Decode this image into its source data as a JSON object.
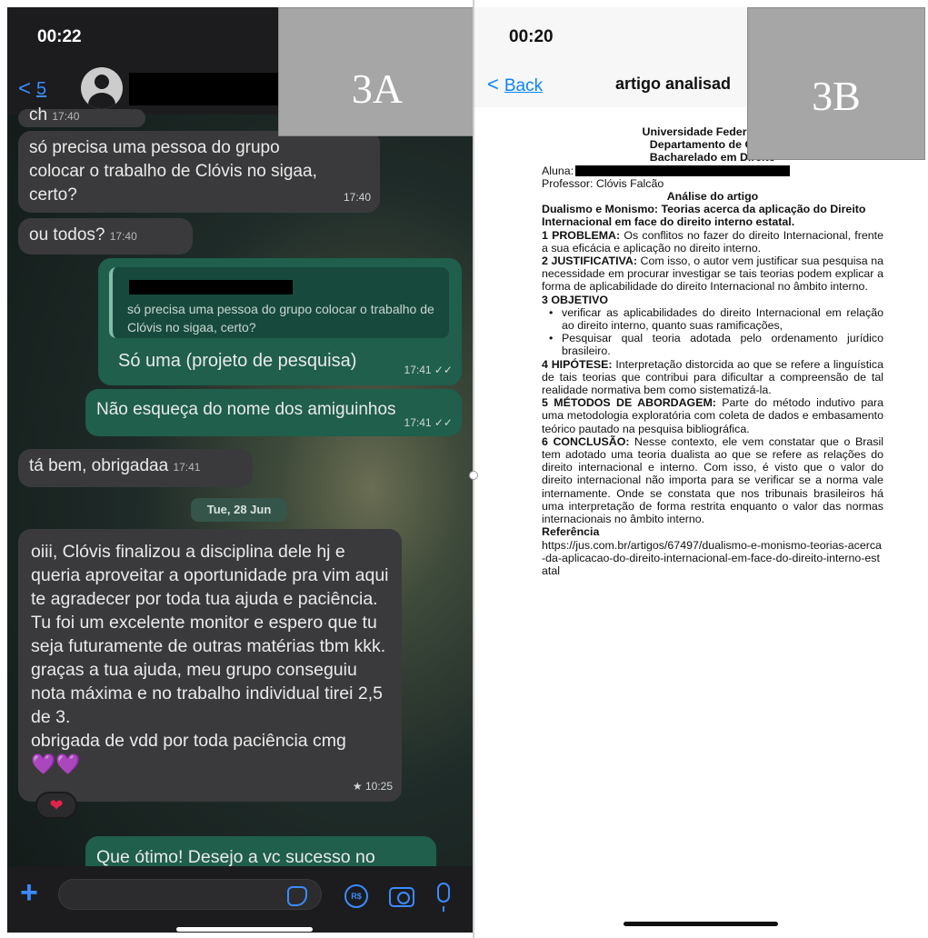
{
  "chat": {
    "status_time": "00:22",
    "back_count": "5",
    "label": "3A",
    "messages": {
      "m0_text": "ch",
      "m0_time": "17:40",
      "m1_text": "só precisa uma pessoa do grupo colocar o trabalho de Clóvis no sigaa, certo?",
      "m1_time": "17:40",
      "m2_text": "ou todos?",
      "m2_time": "17:40",
      "m3_quote": "só precisa uma pessoa do grupo colocar o trabalho de Clóvis no sigaa, certo?",
      "m3_text": "Só uma (projeto de pesquisa)",
      "m3_time": "17:41 ✓✓",
      "m4_text": "Não esqueça do nome dos amiguinhos",
      "m4_time": "17:41 ✓✓",
      "m5_text": "tá bem, obrigadaa",
      "m5_time": "17:41",
      "date_separator": "Tue, 28 Jun",
      "m6_text": "oiii, Clóvis finalizou a disciplina dele hj e queria aproveitar a oportunidade pra vim aqui te agradecer por toda tua ajuda e paciência. Tu foi um excelente monitor e espero que tu seja futuramente de outras matérias tbm kkk. graças a tua ajuda, meu grupo conseguiu nota máxima e no trabalho individual tirei 2,5 de  3.",
      "m6_text2": "obrigada de vdd por toda paciência cmg",
      "m6_emoji": "💜💜",
      "m6_time": "★ 10:25",
      "m6_reaction": "❤",
      "m7_text": "Que ótimo! Desejo a vc sucesso no"
    },
    "composer_icons": [
      "plus-icon",
      "sticker-icon",
      "pix-icon",
      "camera-icon",
      "mic-icon"
    ],
    "pix_label": "R$"
  },
  "doc": {
    "status_time": "00:20",
    "back_label": "Back",
    "nav_title": "artigo analisad",
    "label": "3B",
    "header1": "Universidade Federal da P",
    "header2": "Departamento de Ciênc",
    "header3": "Bacharelado em Direito",
    "aluna_label": "Aluna:",
    "professor": "Professor: Clóvis Falcão",
    "section_title": "Análise do artigo",
    "article_title": "Dualismo e Monismo: Teorias acerca da aplicação do Direito Internacional em face do direito interno estatal.",
    "p1_label": "1 PROBLEMA:",
    "p1_text": " Os conflitos no fazer do direito Internacional, frente a sua eficácia e aplicação no direito interno.",
    "p2_label": "2 JUSTIFICATIVA:",
    "p2_text": " Com isso, o autor vem justificar sua pesquisa na necessidade em procurar investigar se tais teorias podem explicar a forma de aplicabilidade do direito Internacional no âmbito interno.",
    "p3_label": "3 OBJETIVO",
    "p3_item1": "verificar as aplicabilidades do direito Internacional em relação ao direito interno, quanto suas ramificações,",
    "p3_item2": "Pesquisar qual teoria adotada pelo ordenamento jurídico brasileiro.",
    "p4_label": "4 HIPÓTESE:",
    "p4_text": " Interpretação distorcida ao que se refere a linguística  de tais teorias que contribui para dificultar a compreensão de tal realidade normativa bem como sistematizá-la.",
    "p5_label": "5 MÉTODOS DE ABORDAGEM:",
    "p5_text": " Parte do método indutivo para uma metodologia exploratória com coleta de dados e embasamento teórico pautado na pesquisa bibliográfica.",
    "p6_label": "6 CONCLUSÃO:",
    "p6_text": " Nesse contexto, ele vem constatar que o Brasil  tem adotado uma teoria dualista ao que se refere as relações do direito internacional e interno. Com isso, é visto que o valor do direito internacional não importa para se verificar se a norma vale internamente. Onde se constata que nos tribunais brasileiros há uma interpretação de forma restrita enquanto o valor das normas internacionais no âmbito interno.",
    "ref_label": "Referência",
    "ref_url": "https://jus.com.br/artigos/67497/dualismo-e-monismo-teorias-acerca-da-aplicacao-do-direito-internacional-em-face-do-direito-interno-estatal"
  }
}
